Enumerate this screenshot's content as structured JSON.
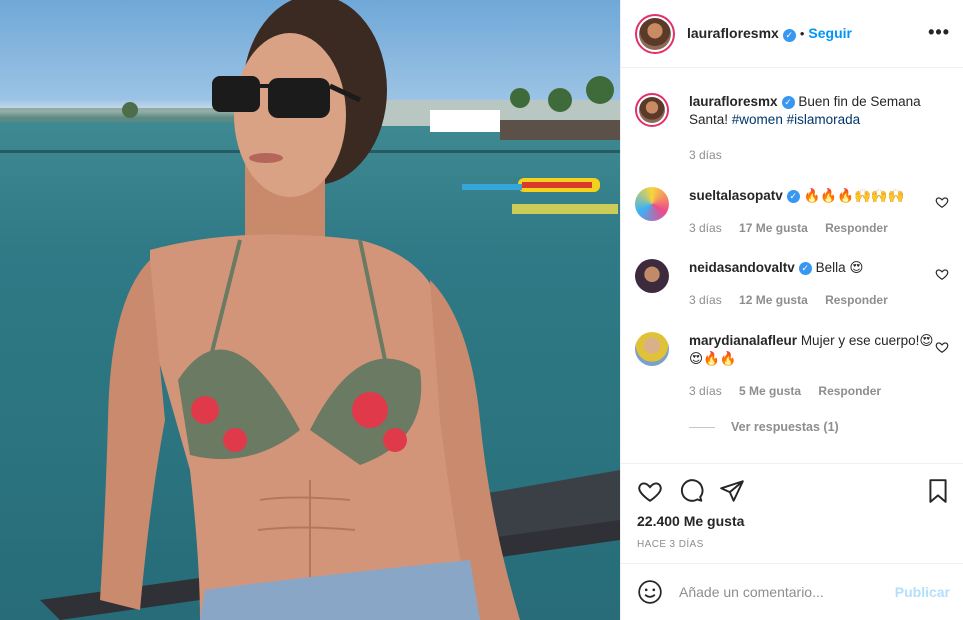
{
  "post": {
    "username": "laurafloresmx",
    "follow_label": "Seguir",
    "more_label": "•••",
    "dot": "•"
  },
  "caption": {
    "username": "laurafloresmx",
    "text": "Buen fin de Semana Santa!",
    "hashtags": "#women #islamorada",
    "time": "3 días"
  },
  "comments": [
    {
      "username": "sueltalasopatv",
      "text": "🔥🔥🔥🙌🙌🙌",
      "time": "3 días",
      "likes": "17 Me gusta",
      "reply": "Responder"
    },
    {
      "username": "neidasandovaltv",
      "text": "Bella 😍",
      "time": "3 días",
      "likes": "12 Me gusta",
      "reply": "Responder"
    },
    {
      "username": "marydianalafleur",
      "text": "Mujer y ese cuerpo!😍😍🔥🔥",
      "time": "3 días",
      "likes": "5 Me gusta",
      "reply": "Responder"
    }
  ],
  "view_replies": "Ver respuestas (1)",
  "likes_count": "22.400 Me gusta",
  "posted_ago": "HACE 3 DÍAS",
  "add_comment": {
    "placeholder": "Añade un comentario...",
    "publish_label": "Publicar"
  },
  "colors": {
    "accent": "#0095f6",
    "verified": "#3897f0",
    "muted": "#8e8e8e"
  }
}
